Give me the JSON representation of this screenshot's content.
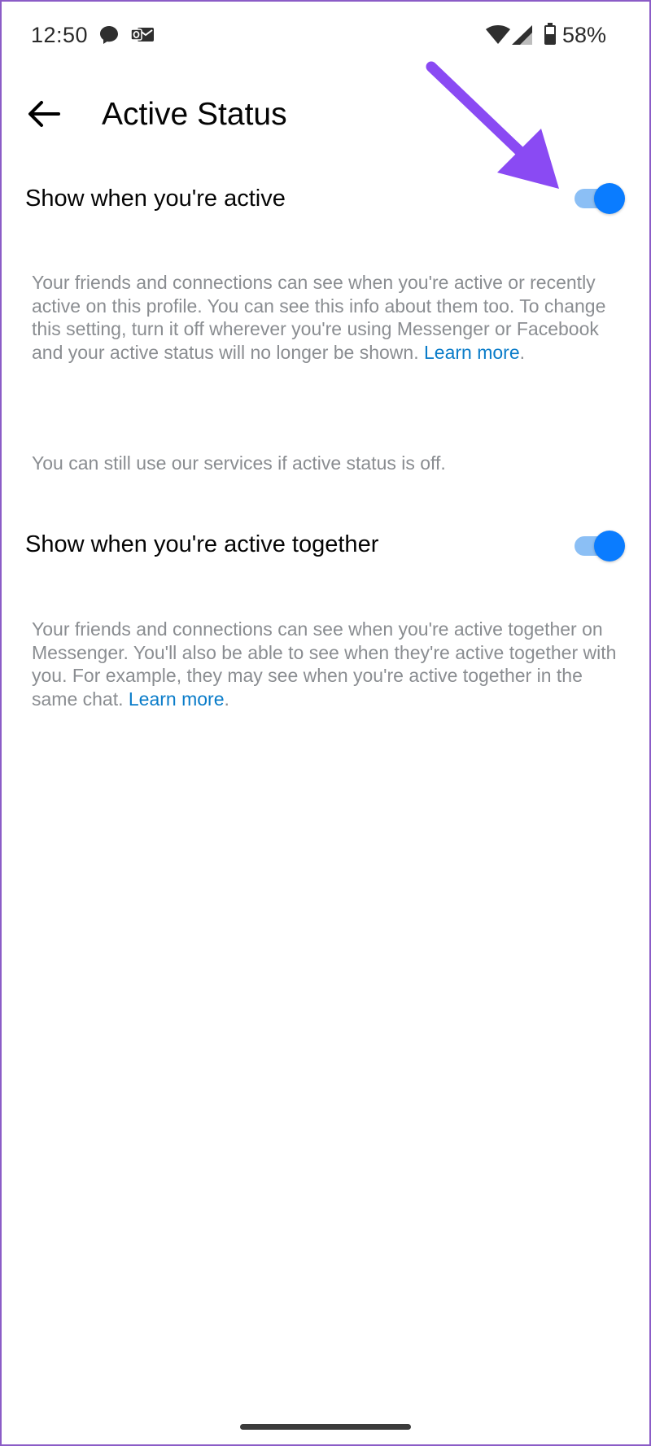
{
  "status_bar": {
    "time": "12:50",
    "battery": "58%",
    "icons": [
      "chat-icon",
      "outlook-mail-icon",
      "wifi-icon",
      "signal-icon",
      "battery-icon"
    ]
  },
  "header": {
    "back_icon": "back-arrow-icon",
    "title": "Active Status"
  },
  "settings": [
    {
      "label": "Show when you're active",
      "enabled": true,
      "description": "Your friends and connections can see when you're active or recently active on this profile. You can see this info about them too. To change this setting, turn it off wherever you're using Messenger or Facebook and your active status will no longer be shown. ",
      "link_text": "Learn more",
      "link_suffix": "."
    },
    {
      "label": "Show when you're active together",
      "enabled": true,
      "description": "Your friends and connections can see when you're active together on Messenger. You'll also be able to see when they're active together with you. For example, they may see when you're active together in the same chat. ",
      "link_text": "Learn more",
      "link_suffix": "."
    }
  ],
  "note": "You can still use our services if active status is off.",
  "colors": {
    "accent": "#0a7cff",
    "track": "#8bbff5",
    "description": "#8a8d91",
    "link": "#0a7cc9",
    "annotation_arrow": "#8a4af3"
  }
}
